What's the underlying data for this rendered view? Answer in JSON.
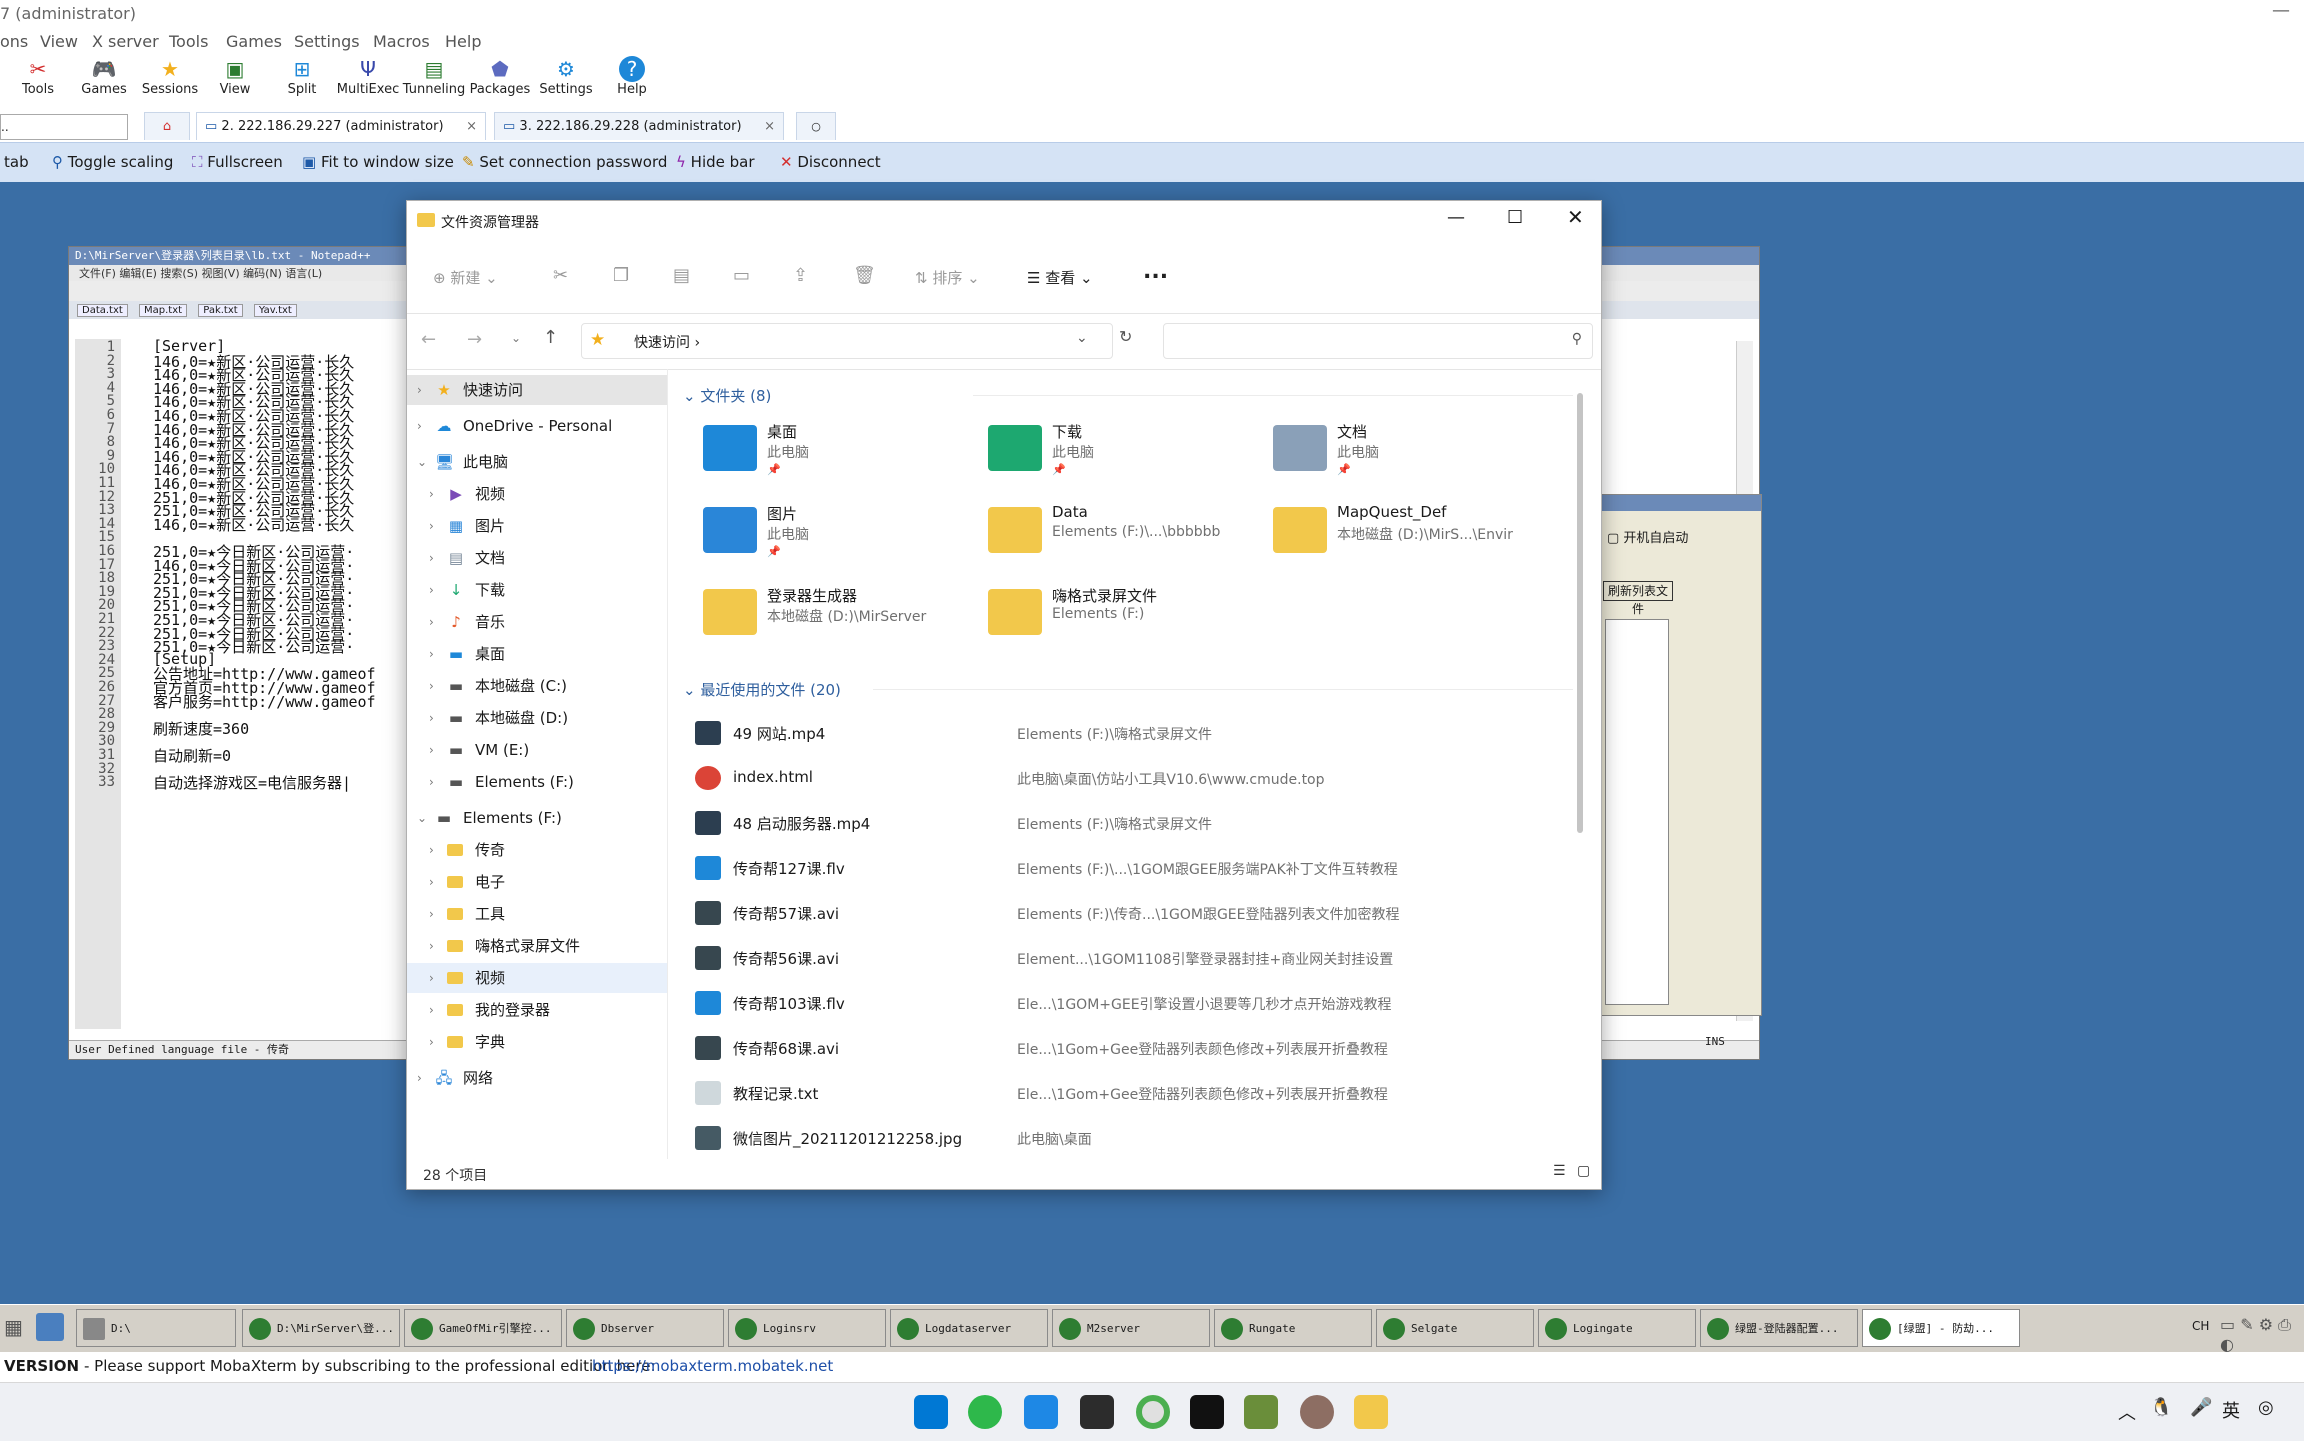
{
  "moba": {
    "title": "7 (administrator)",
    "menu": [
      "ons",
      "View",
      "X server",
      "Tools",
      "Games",
      "Settings",
      "Macros",
      "Help"
    ],
    "toolbar": [
      {
        "label": "Tools",
        "icon": "tools-icon"
      },
      {
        "label": "Games",
        "icon": "games-icon"
      },
      {
        "label": "Sessions",
        "icon": "sessions-icon"
      },
      {
        "label": "View",
        "icon": "view-icon"
      },
      {
        "label": "Split",
        "icon": "split-icon"
      },
      {
        "label": "MultiExec",
        "icon": "multiexec-icon"
      },
      {
        "label": "Tunneling",
        "icon": "tunneling-icon"
      },
      {
        "label": "Packages",
        "icon": "packages-icon"
      },
      {
        "label": "Settings",
        "icon": "settings-icon"
      },
      {
        "label": "Help",
        "icon": "help-icon"
      }
    ],
    "tabs": [
      "2. 222.186.29.227 (administrator)",
      "3. 222.186.29.228 (administrator)"
    ],
    "sessionbar": [
      "tab",
      "Toggle scaling",
      "Fullscreen",
      "Fit to window size",
      "Set connection password",
      "Hide bar",
      "Disconnect"
    ],
    "status": {
      "version": "VERSION",
      "message": "- Please support MobaXterm by subscribing to the professional edition here:",
      "link": "https://mobaxterm.mobatek.net"
    },
    "taskbar": [
      "D:\\",
      "D:\\MirServer\\登...",
      "GameOfMir引擎控...",
      "Dbserver",
      "Loginsrv",
      "Logdataserver",
      "M2server",
      "Rungate",
      "Selgate",
      "Logingate",
      "绿盟-登陆器配置...",
      "[绿盟] - 防劫..."
    ],
    "tray": "CH"
  },
  "npp": {
    "title": "D:\\MirServer\\登录器\\列表目录\\lb.txt - Notepad++",
    "menu": "文件(F)  编辑(E)  搜索(S)  视图(V)  编码(N)  语言(L)",
    "filetabs": [
      "Data.txt",
      "Map.txt",
      "Pak.txt",
      "Yav.txt"
    ],
    "lines": [
      "[Server]",
      "146,0=★新区·公司运营·长久",
      "146,0=★新区·公司运营·长久",
      "146,0=★新区·公司运营·长久",
      "146,0=★新区·公司运营·长久",
      "146,0=★新区·公司运营·长久",
      "146,0=★新区·公司运营·长久",
      "146,0=★新区·公司运营·长久",
      "146,0=★新区·公司运营·长久",
      "146,0=★新区·公司运营·长久",
      "146,0=★新区·公司运营·长久",
      "251,0=★新区·公司运营·长久",
      "251,0=★新区·公司运营·长久",
      "146,0=★新区·公司运营·长久",
      "",
      "251,0=★今日新区·公司运营·",
      "146,0=★今日新区·公司运营·",
      "251,0=★今日新区·公司运营·",
      "251,0=★今日新区·公司运营·",
      "251,0=★今日新区·公司运营·",
      "251,0=★今日新区·公司运营·",
      "251,0=★今日新区·公司运营·",
      "251,0=★今日新区·公司运营·",
      "[Setup]",
      "公告地址=http://www.gameof",
      "官方首页=http://www.gameof",
      "客户服务=http://www.gameof",
      "",
      "刷新速度=360",
      "",
      "自动刷新=0",
      "",
      "自动选择游戏区=电信服务器|"
    ],
    "status": "User Defined language file - 传奇"
  },
  "side": {
    "autostart": "开机自启动",
    "btn": "刷新列表文件",
    "ins": "INS"
  },
  "explorer": {
    "title": "文件资源管理器",
    "cmd": {
      "new": "新建",
      "sort": "排序",
      "view": "查看",
      "more": "..."
    },
    "address": "快速访问",
    "nav": [
      {
        "label": "快速访问",
        "level": 0
      },
      {
        "label": "OneDrive - Personal",
        "level": 0
      },
      {
        "label": "此电脑",
        "level": 0
      },
      {
        "label": "视频",
        "level": 1
      },
      {
        "label": "图片",
        "level": 1
      },
      {
        "label": "文档",
        "level": 1
      },
      {
        "label": "下载",
        "level": 1
      },
      {
        "label": "音乐",
        "level": 1
      },
      {
        "label": "桌面",
        "level": 1
      },
      {
        "label": "本地磁盘 (C:)",
        "level": 1
      },
      {
        "label": "本地磁盘 (D:)",
        "level": 1
      },
      {
        "label": "VM (E:)",
        "level": 1
      },
      {
        "label": "Elements (F:)",
        "level": 1
      },
      {
        "label": "Elements (F:)",
        "level": 0
      },
      {
        "label": "传奇",
        "level": 1
      },
      {
        "label": "电子",
        "level": 1
      },
      {
        "label": "工具",
        "level": 1
      },
      {
        "label": "嗨格式录屏文件",
        "level": 1
      },
      {
        "label": "视频",
        "level": 1
      },
      {
        "label": "我的登录器",
        "level": 1
      },
      {
        "label": "字典",
        "level": 1
      },
      {
        "label": "网络",
        "level": 0
      }
    ],
    "folders_header": "文件夹 (8)",
    "folders": [
      {
        "name": "桌面",
        "sub": "此电脑",
        "pin": "📌",
        "color": "#1e88d8"
      },
      {
        "name": "下载",
        "sub": "此电脑",
        "pin": "📌",
        "color": "#1da870"
      },
      {
        "name": "文档",
        "sub": "此电脑",
        "pin": "📌",
        "color": "#8aa0b8"
      },
      {
        "name": "图片",
        "sub": "此电脑",
        "pin": "📌",
        "color": "#2a86d8"
      },
      {
        "name": "Data",
        "sub": "Elements (F:)\\...\\bbbbbb",
        "pin": "",
        "color": "#f2c84b"
      },
      {
        "name": "MapQuest_Def",
        "sub": "本地磁盘 (D:)\\MirS...\\Envir",
        "pin": "",
        "color": "#f2c84b"
      },
      {
        "name": "登录器生成器",
        "sub": "本地磁盘 (D:)\\MirServer",
        "pin": "",
        "color": "#f2c84b"
      },
      {
        "name": "嗨格式录屏文件",
        "sub": "Elements (F:)",
        "pin": "",
        "color": "#f2c84b"
      }
    ],
    "recent_header": "最近使用的文件 (20)",
    "recent": [
      {
        "name": "49 网站.mp4",
        "path": "Elements (F:)\\嗨格式录屏文件",
        "icon": "video-file-icon"
      },
      {
        "name": "index.html",
        "path": "此电脑\\桌面\\仿站小工具V10.6\\www.cmude.top",
        "icon": "chrome-file-icon"
      },
      {
        "name": "48 启动服务器.mp4",
        "path": "Elements (F:)\\嗨格式录屏文件",
        "icon": "video-file-icon"
      },
      {
        "name": "传奇帮127课.flv",
        "path": "Elements (F:)\\...\\1GOM跟GEE服务端PAK补丁文件互转教程",
        "icon": "flv-file-icon"
      },
      {
        "name": "传奇帮57课.avi",
        "path": "Elements (F:)\\传奇...\\1GOM跟GEE登陆器列表文件加密教程",
        "icon": "avi-file-icon"
      },
      {
        "name": "传奇帮56课.avi",
        "path": "Element...\\1GOM1108引擎登录器封挂+商业网关封挂设置",
        "icon": "avi-file-icon"
      },
      {
        "name": "传奇帮103课.flv",
        "path": "Ele...\\1GOM+GEE引擎设置小退要等几秒才点开始游戏教程",
        "icon": "flv-file-icon"
      },
      {
        "name": "传奇帮68课.avi",
        "path": "Ele...\\1Gom+Gee登陆器列表颜色修改+列表展开折叠教程",
        "icon": "avi-file-icon"
      },
      {
        "name": "教程记录.txt",
        "path": "Ele...\\1Gom+Gee登陆器列表颜色修改+列表展开折叠教程",
        "icon": "txt-file-icon"
      },
      {
        "name": "微信图片_20211201212258.jpg",
        "path": "此电脑\\桌面",
        "icon": "jpg-file-icon"
      }
    ],
    "status": "28 个项目"
  }
}
